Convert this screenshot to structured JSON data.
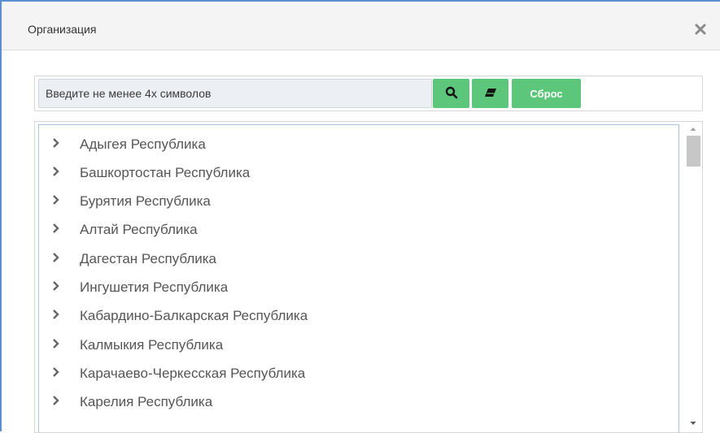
{
  "dialog": {
    "title": "Организация",
    "close_icon": "close-icon"
  },
  "search": {
    "placeholder": "Введите не менее 4х символов",
    "search_icon": "search-icon",
    "clear_icon": "eraser-icon",
    "reset_label": "Сброс"
  },
  "tree": {
    "items": [
      {
        "label": "Адыгея Республика"
      },
      {
        "label": "Башкортостан Республика"
      },
      {
        "label": "Бурятия Республика"
      },
      {
        "label": "Алтай Республика"
      },
      {
        "label": "Дагестан Республика"
      },
      {
        "label": "Ингушетия Республика"
      },
      {
        "label": "Кабардино-Балкарская Республика"
      },
      {
        "label": "Калмыкия Республика"
      },
      {
        "label": "Карачаево-Черкесская Республика"
      },
      {
        "label": "Карелия Республика"
      }
    ],
    "expand_icon": "chevron-right-icon"
  },
  "colors": {
    "accent_green": "#5cc77a",
    "border_blue": "#5b8fd0"
  }
}
